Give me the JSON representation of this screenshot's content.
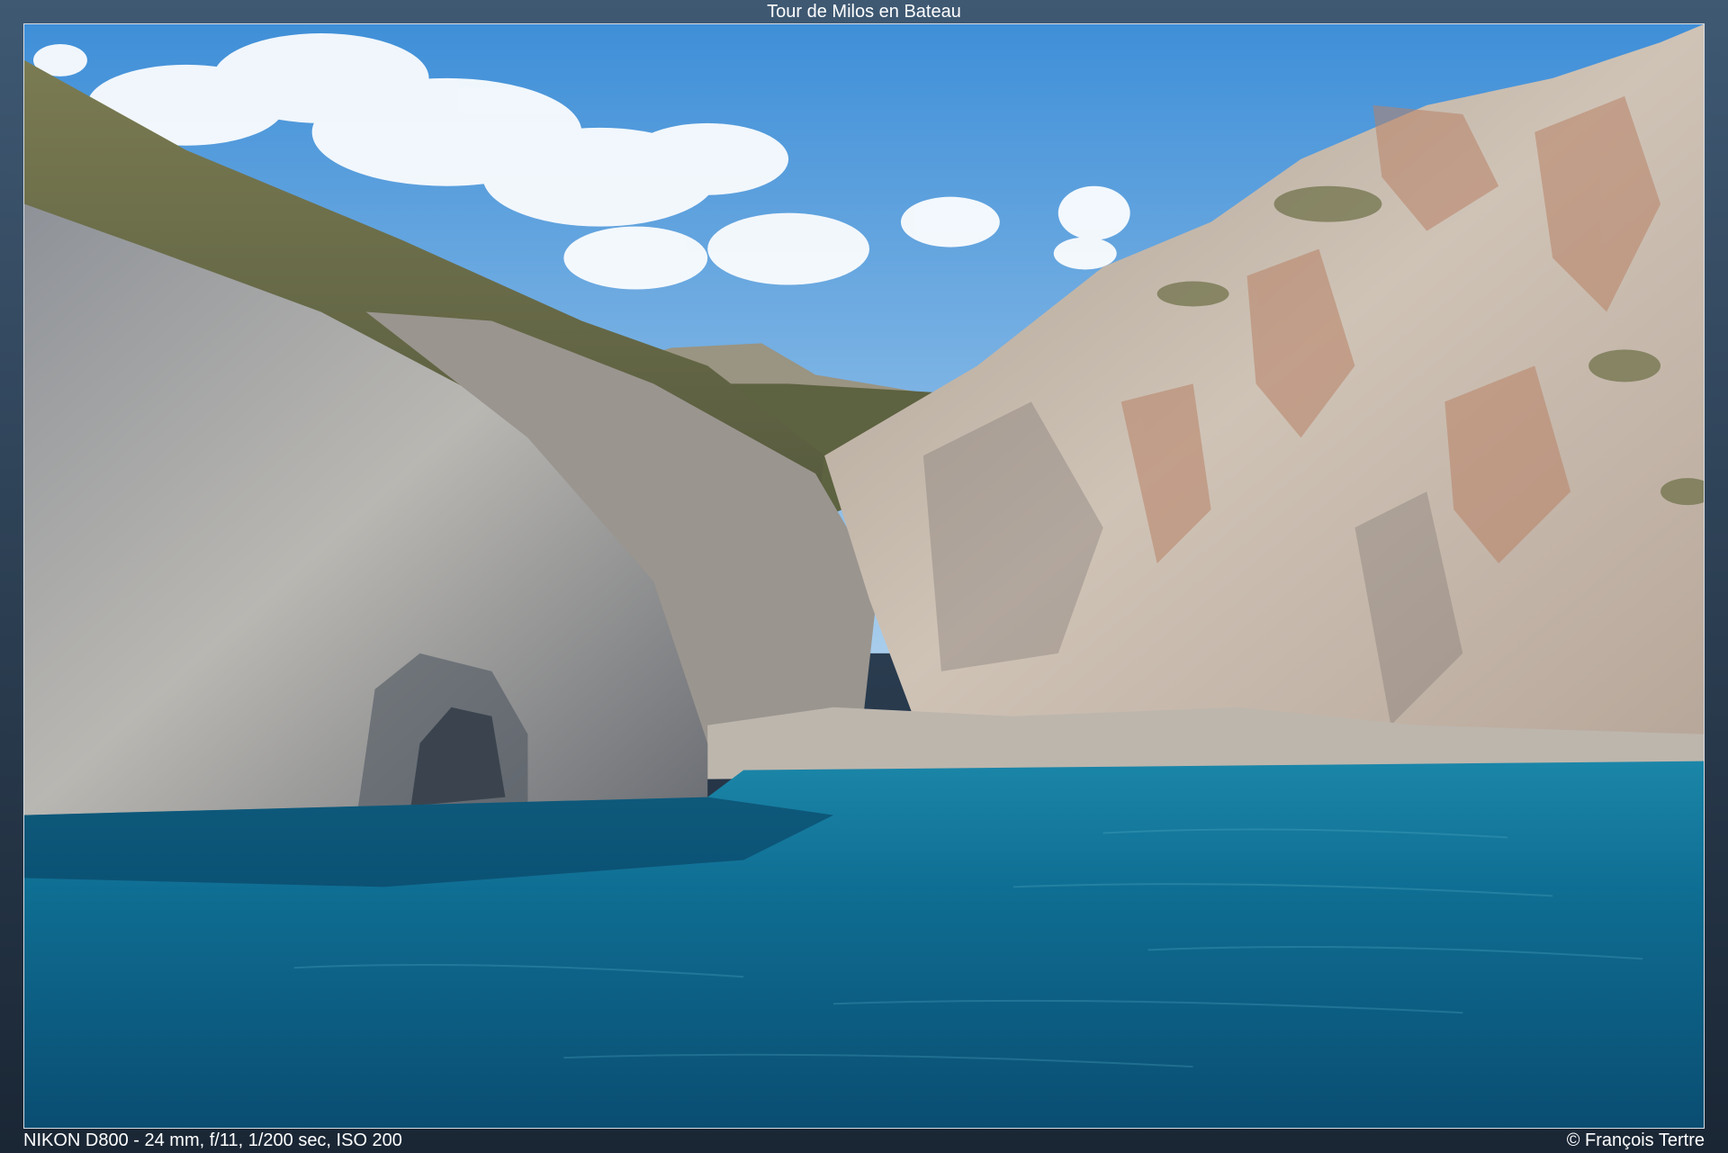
{
  "title": "Tour de Milos en Bateau",
  "exif": "NIKON D800 - 24 mm, f/11, 1/200 sec, ISO 200",
  "copyright": "© François Tertre",
  "colors": {
    "sky_top": "#3f8fd8",
    "sky_bottom": "#a8cdec",
    "sea_near": "#0a4d72",
    "sea_far": "#1b86a8",
    "cliff_light": "#c9c4bb",
    "cliff_shadow": "#5a6068",
    "rock_rust": "#b88266",
    "vegetation": "#6b6d45"
  }
}
